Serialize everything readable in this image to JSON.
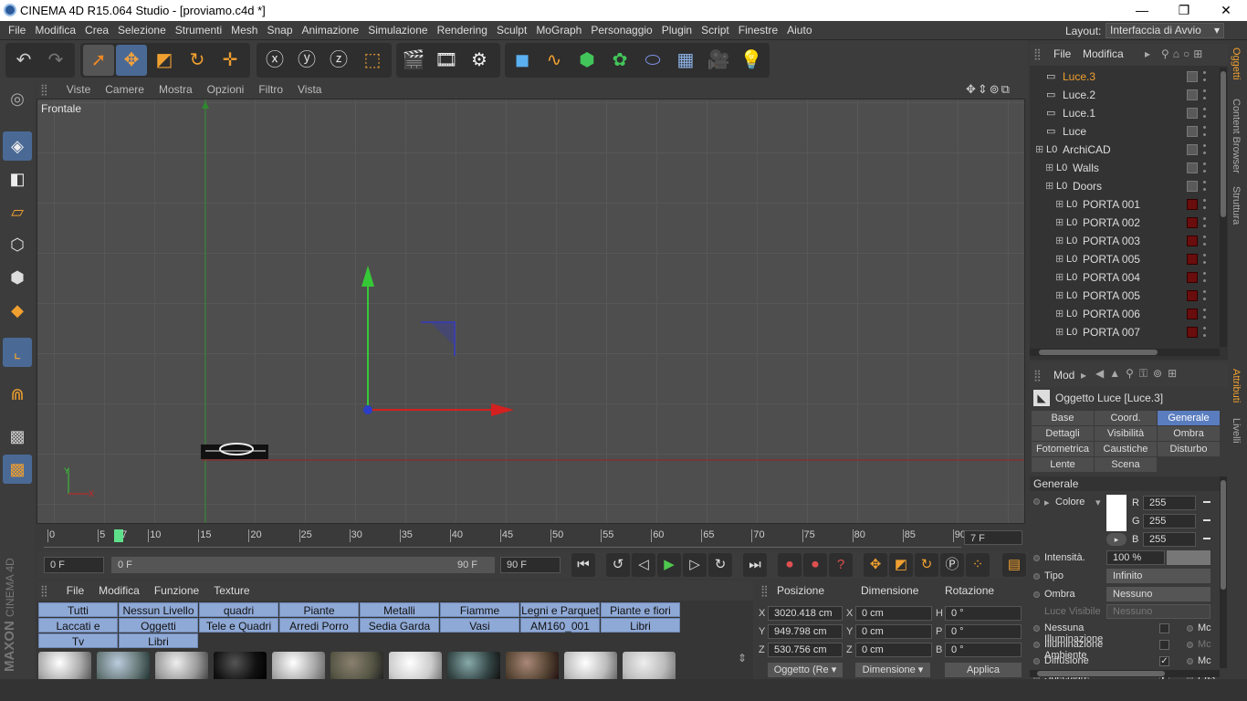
{
  "window": {
    "title": "CINEMA 4D R15.064 Studio - [proviamo.c4d *]",
    "minimize": "—",
    "maximize": "❐",
    "close": "✕"
  },
  "menubar": {
    "items": [
      "File",
      "Modifica",
      "Crea",
      "Selezione",
      "Strumenti",
      "Mesh",
      "Snap",
      "Animazione",
      "Simulazione",
      "Rendering",
      "Sculpt",
      "MoGraph",
      "Personaggio",
      "Plugin",
      "Script",
      "Finestre",
      "Aiuto"
    ],
    "layout_label": "Layout:",
    "layout_value": "Interfaccia di Avvio"
  },
  "viewport": {
    "menu": [
      "Viste",
      "Camere",
      "Mostra",
      "Opzioni",
      "Filtro",
      "Vista"
    ],
    "label": "Frontale",
    "axis_y": "Y",
    "axis_x": "X"
  },
  "timeline": {
    "ticks": [
      "0",
      "5",
      "10",
      "15",
      "20",
      "25",
      "30",
      "35",
      "40",
      "45",
      "50",
      "55",
      "60",
      "65",
      "70",
      "75",
      "80",
      "85",
      "90"
    ],
    "current": "7",
    "frame_field": "7 F",
    "start": "0 F",
    "range_start": "0 F",
    "range_end": "90 F",
    "end": "90 F"
  },
  "materials": {
    "menu": [
      "File",
      "Modifica",
      "Funzione",
      "Texture"
    ],
    "layers": [
      "Tutti",
      "Nessun Livello",
      "quadri",
      "Piante",
      "Metalli",
      "Fiamme",
      "Legni e Parquet",
      "Piante e fiori",
      "Laccati e Resine",
      "Oggetti",
      "Tele e Quadri",
      "Arredi Porro",
      "Sedia Garda",
      "Vasi",
      "AM160_001",
      "Libri",
      "Tv",
      "Libri"
    ]
  },
  "coords": {
    "headers": [
      "Posizione",
      "Dimensione",
      "Rotazione"
    ],
    "rows": [
      {
        "axis": "X",
        "pos": "3020.418 cm",
        "dim_axis": "X",
        "dim": "0 cm",
        "rot_axis": "H",
        "rot": "0 °"
      },
      {
        "axis": "Y",
        "pos": "949.798 cm",
        "dim_axis": "Y",
        "dim": "0 cm",
        "rot_axis": "P",
        "rot": "0 °"
      },
      {
        "axis": "Z",
        "pos": "530.756 cm",
        "dim_axis": "Z",
        "dim": "0 cm",
        "rot_axis": "B",
        "rot": "0 °"
      }
    ],
    "mode": "Oggetto (Re",
    "size_mode": "Dimensione",
    "apply": "Applica"
  },
  "objects": {
    "menu": [
      "File",
      "Modifica"
    ],
    "items": [
      {
        "name": "Luce.3",
        "selected": true,
        "indent": 0
      },
      {
        "name": "Luce.2",
        "indent": 0
      },
      {
        "name": "Luce.1",
        "indent": 0
      },
      {
        "name": "Luce",
        "indent": 0
      },
      {
        "name": "ArchiCAD",
        "indent": 0,
        "null": true
      },
      {
        "name": "Walls",
        "indent": 1,
        "null": true
      },
      {
        "name": "Doors",
        "indent": 1,
        "null": true
      },
      {
        "name": "PORTA 001",
        "indent": 2,
        "null": true,
        "mat": true
      },
      {
        "name": "PORTA 002",
        "indent": 2,
        "null": true,
        "mat": true
      },
      {
        "name": "PORTA 003",
        "indent": 2,
        "null": true,
        "mat": true
      },
      {
        "name": "PORTA 005",
        "indent": 2,
        "null": true,
        "mat": true
      },
      {
        "name": "PORTA 004",
        "indent": 2,
        "null": true,
        "mat": true
      },
      {
        "name": "PORTA 005",
        "indent": 2,
        "null": true,
        "mat": true
      },
      {
        "name": "PORTA 006",
        "indent": 2,
        "null": true,
        "mat": true
      },
      {
        "name": "PORTA 007",
        "indent": 2,
        "null": true,
        "mat": true
      }
    ]
  },
  "side_tabs": [
    "Oggetti",
    "Content Browser",
    "Struttura",
    "Attributi",
    "Livelli"
  ],
  "attributes": {
    "mode": "Mod",
    "object_title": "Oggetto Luce [Luce.3]",
    "tabs": [
      "Base",
      "Coord.",
      "Generale",
      "Dettagli",
      "Visibilità",
      "Ombra",
      "Fotometrica",
      "Caustiche",
      "Disturbo",
      "Lente",
      "Scena"
    ],
    "section": "Generale",
    "color_label": "Colore",
    "r_label": "R",
    "g_label": "G",
    "b_label": "B",
    "r": "255",
    "g": "255",
    "b": "255",
    "intensity_label": "Intensità.",
    "intensity": "100 %",
    "type_label": "Tipo",
    "type": "Infinito",
    "shadow_label": "Ombra",
    "shadow": "Nessuno",
    "visible_label": "Luce Visibile",
    "visible": "Nessuno",
    "checks": [
      "Nessuna Illuminazione",
      "Illuminazione Ambiente",
      "Diffusione",
      "Speculare"
    ],
    "right_checks": [
      "Mc",
      "Mc",
      "Mc",
      "Pas"
    ]
  }
}
